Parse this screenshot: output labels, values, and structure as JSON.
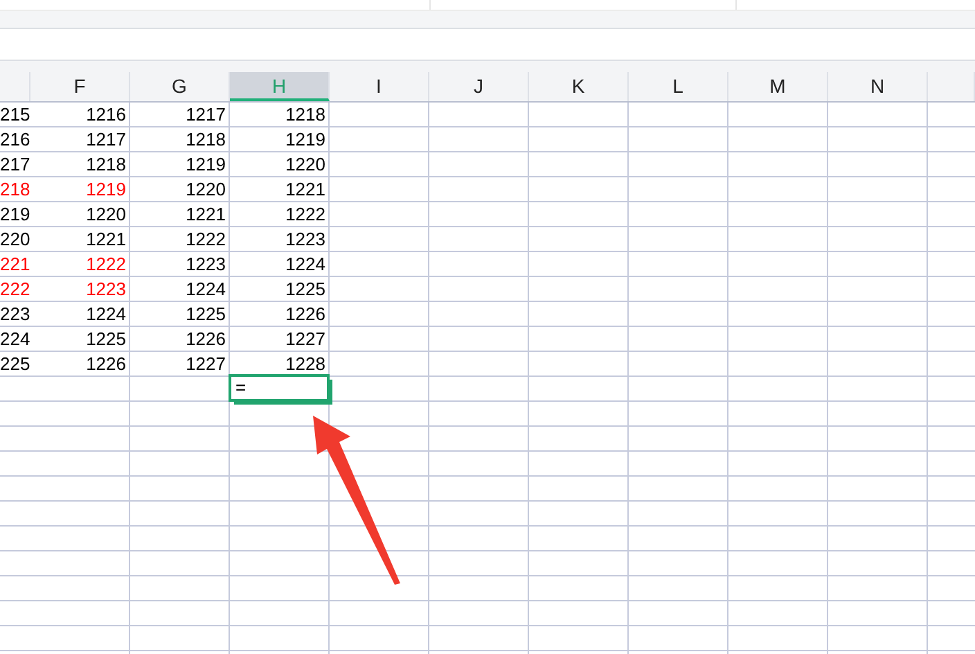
{
  "columns": [
    {
      "selected": false
    },
    {
      "label": "F",
      "selected": false
    },
    {
      "label": "G",
      "selected": false
    },
    {
      "label": "H",
      "selected": true
    },
    {
      "label": "I",
      "selected": false
    },
    {
      "label": "J",
      "selected": false
    },
    {
      "label": "K",
      "selected": false
    },
    {
      "label": "L",
      "selected": false
    },
    {
      "label": "M",
      "selected": false
    },
    {
      "label": "N",
      "selected": false
    }
  ],
  "rows": [
    {
      "kind": "data",
      "cells": [
        {
          "text": "215",
          "color": "#000000"
        },
        {
          "text": "1216",
          "color": "#000000"
        },
        {
          "text": "1217",
          "color": "#000000"
        },
        {
          "text": "1218",
          "color": "#000000"
        }
      ]
    },
    {
      "kind": "data",
      "cells": [
        {
          "text": "216",
          "color": "#000000"
        },
        {
          "text": "1217",
          "color": "#000000"
        },
        {
          "text": "1218",
          "color": "#000000"
        },
        {
          "text": "1219",
          "color": "#000000"
        }
      ]
    },
    {
      "kind": "data",
      "cells": [
        {
          "text": "217",
          "color": "#000000"
        },
        {
          "text": "1218",
          "color": "#000000"
        },
        {
          "text": "1219",
          "color": "#000000"
        },
        {
          "text": "1220",
          "color": "#000000"
        }
      ]
    },
    {
      "kind": "data",
      "cells": [
        {
          "text": "218",
          "color": "#ff0000"
        },
        {
          "text": "1219",
          "color": "#ff0000"
        },
        {
          "text": "1220",
          "color": "#000000"
        },
        {
          "text": "1221",
          "color": "#000000"
        }
      ]
    },
    {
      "kind": "data",
      "cells": [
        {
          "text": "219",
          "color": "#000000"
        },
        {
          "text": "1220",
          "color": "#000000"
        },
        {
          "text": "1221",
          "color": "#000000"
        },
        {
          "text": "1222",
          "color": "#000000"
        }
      ]
    },
    {
      "kind": "data",
      "cells": [
        {
          "text": "220",
          "color": "#000000"
        },
        {
          "text": "1221",
          "color": "#000000"
        },
        {
          "text": "1222",
          "color": "#000000"
        },
        {
          "text": "1223",
          "color": "#000000"
        }
      ]
    },
    {
      "kind": "data",
      "cells": [
        {
          "text": "221",
          "color": "#ff0000"
        },
        {
          "text": "1222",
          "color": "#ff0000"
        },
        {
          "text": "1223",
          "color": "#000000"
        },
        {
          "text": "1224",
          "color": "#000000"
        }
      ]
    },
    {
      "kind": "data",
      "cells": [
        {
          "text": "222",
          "color": "#ff0000"
        },
        {
          "text": "1223",
          "color": "#ff0000"
        },
        {
          "text": "1224",
          "color": "#000000"
        },
        {
          "text": "1225",
          "color": "#000000"
        }
      ]
    },
    {
      "kind": "data",
      "cells": [
        {
          "text": "223",
          "color": "#000000"
        },
        {
          "text": "1224",
          "color": "#000000"
        },
        {
          "text": "1225",
          "color": "#000000"
        },
        {
          "text": "1226",
          "color": "#000000"
        }
      ]
    },
    {
      "kind": "data",
      "cells": [
        {
          "text": "224",
          "color": "#000000"
        },
        {
          "text": "1225",
          "color": "#000000"
        },
        {
          "text": "1226",
          "color": "#000000"
        },
        {
          "text": "1227",
          "color": "#000000"
        }
      ]
    },
    {
      "kind": "data",
      "cells": [
        {
          "text": "225",
          "color": "#000000"
        },
        {
          "text": "1226",
          "color": "#000000"
        },
        {
          "text": "1227",
          "color": "#000000"
        },
        {
          "text": "1228",
          "color": "#000000"
        }
      ]
    },
    {
      "kind": "input",
      "cells": [
        null,
        null,
        null,
        {
          "text": "="
        }
      ]
    }
  ]
}
